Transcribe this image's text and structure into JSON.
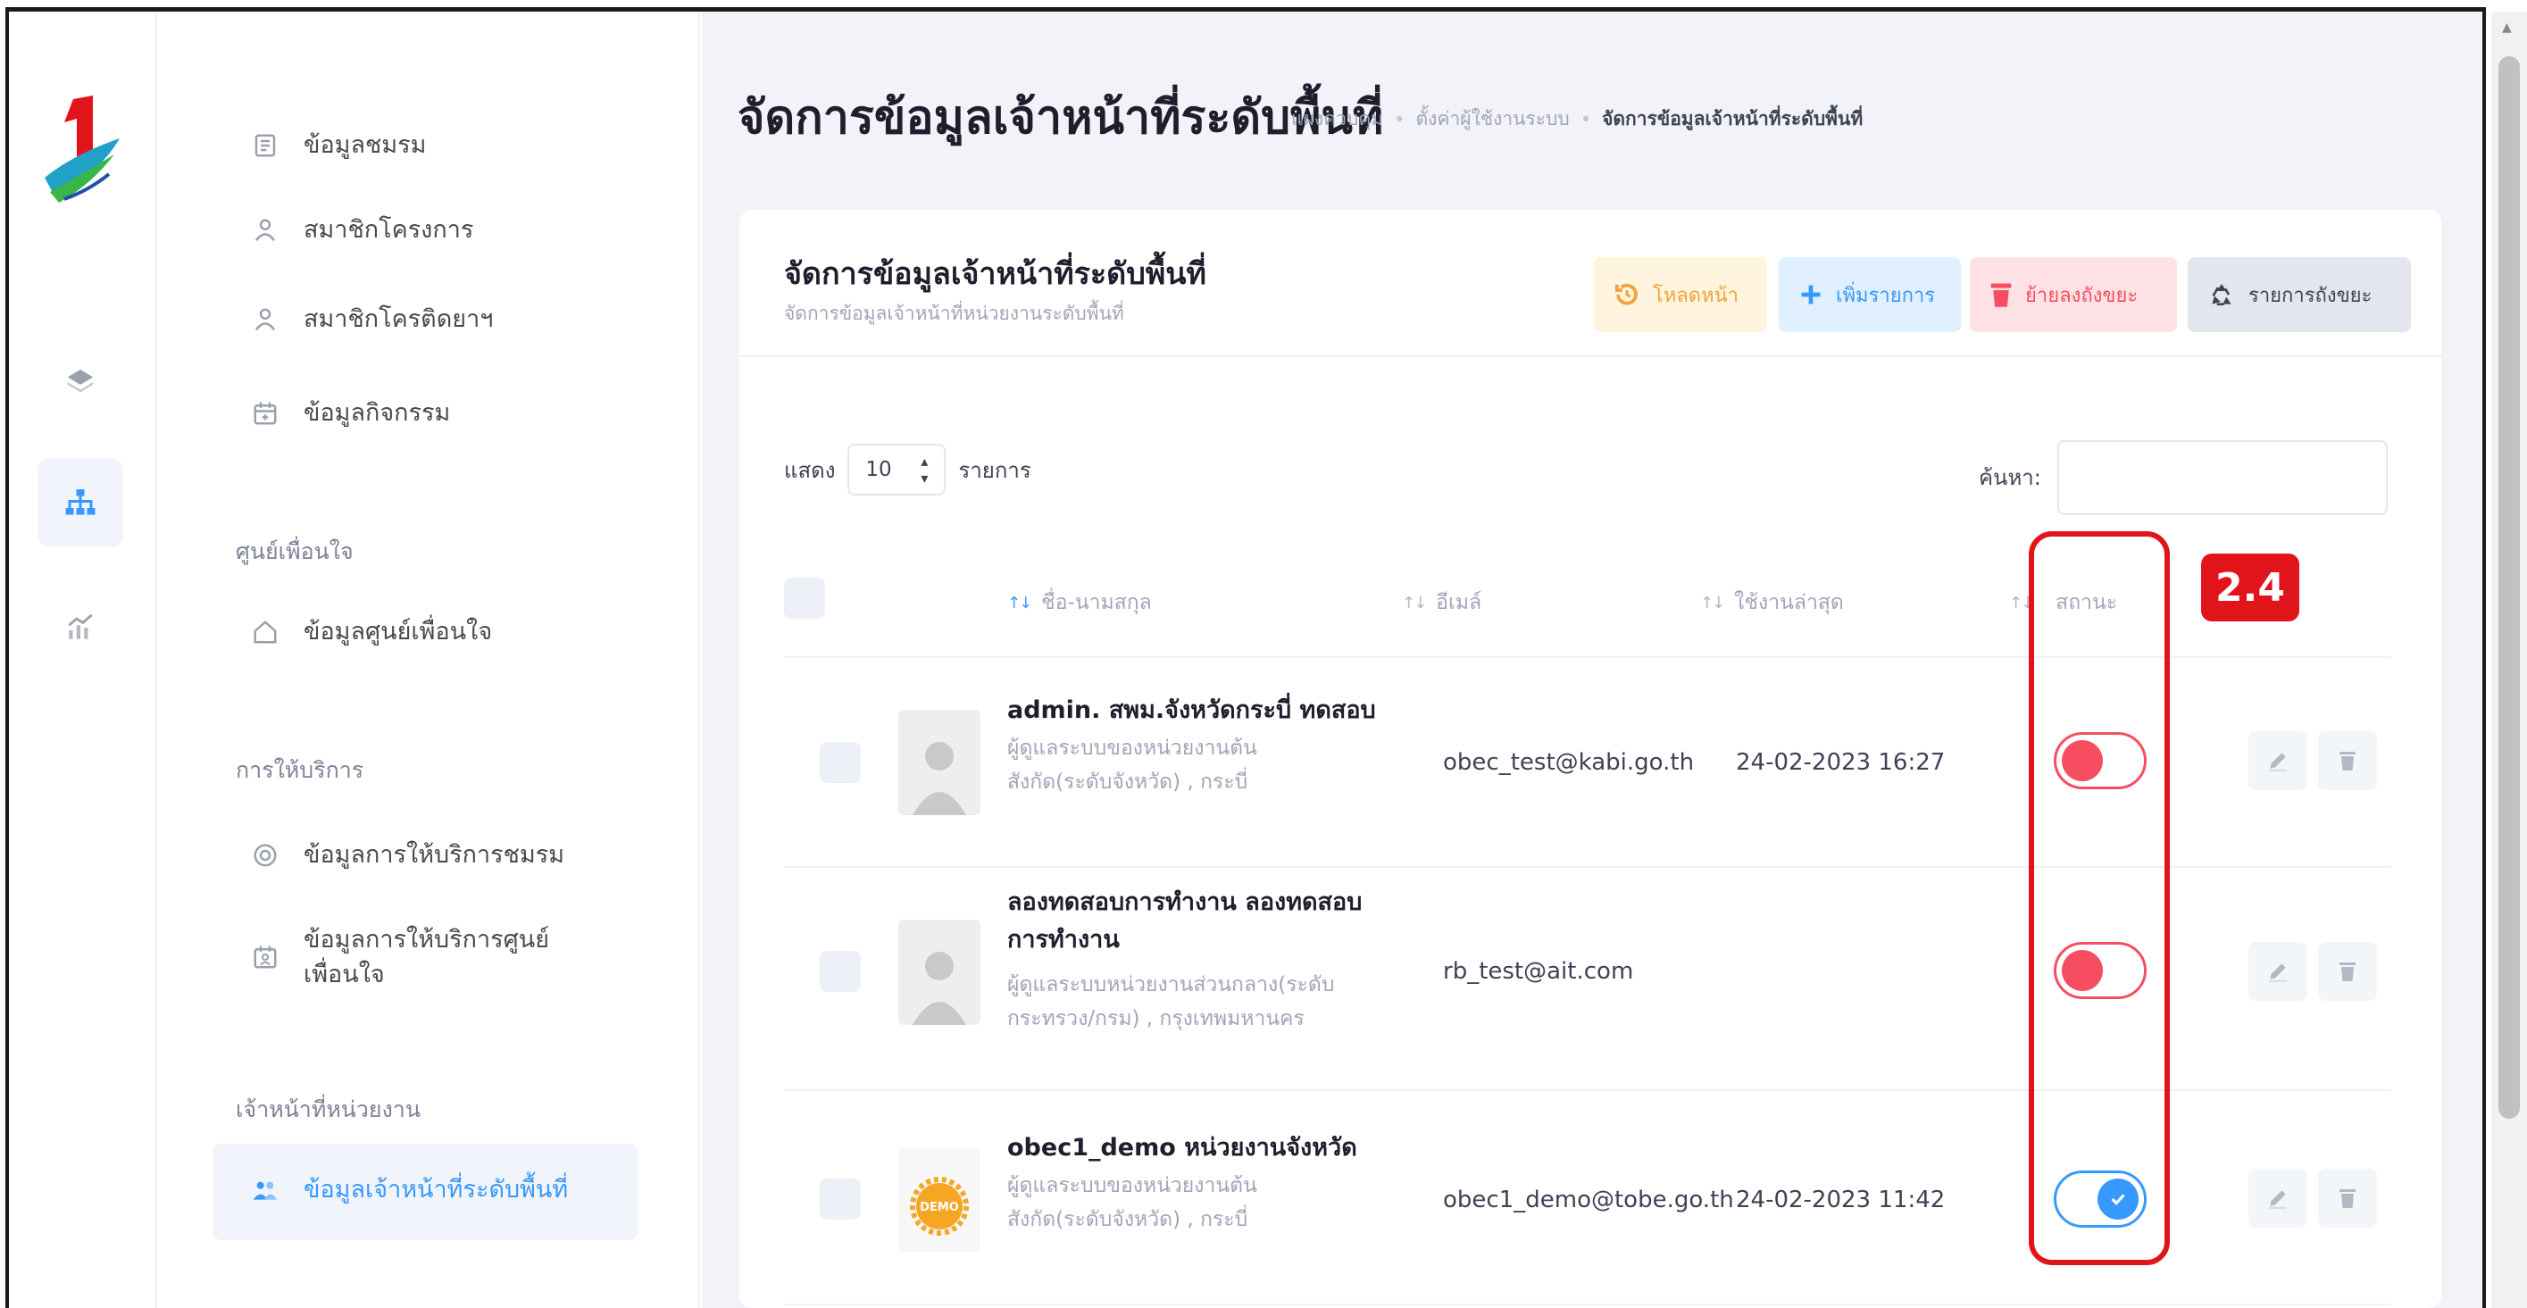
{
  "sidebar": {
    "items_top": [
      {
        "label": "ข้อมูลชมรม",
        "icon": "club-icon"
      },
      {
        "label": "สมาชิกโครงการ",
        "icon": "members-icon"
      },
      {
        "label": "สมาชิกโครติดยาฯ",
        "icon": "members-icon"
      },
      {
        "label": "ข้อมูลกิจกรรม",
        "icon": "calendar-icon"
      }
    ],
    "section_center": "ศูนย์เพื่อนใจ",
    "item_center": "ข้อมูลศูนย์เพื่อนใจ",
    "section_service": "การให้บริการ",
    "item_service_club": "ข้อมูลการให้บริการชมรม",
    "item_service_center_line1": "ข้อมูลการให้บริการศูนย์",
    "item_service_center_line2": "เพื่อนใจ",
    "section_staff": "เจ้าหน้าที่หน่วยงาน",
    "item_staff": "ข้อมูลเจ้าหน้าที่ระดับพื้นที่"
  },
  "header": {
    "title": "จัดการข้อมูลเจ้าหน้าที่ระดับพื้นที่",
    "breadcrumb": [
      "แผงควบคุม",
      "ตั้งค่าผู้ใช้งานระบบ",
      "จัดการข้อมูลเจ้าหน้าที่ระดับพื้นที่"
    ]
  },
  "card": {
    "title": "จัดการข้อมูลเจ้าหน้าที่ระดับพื้นที่",
    "subtitle": "จัดการข้อมูลเจ้าหน้าที่หน่วยงานระดับพื้นที่",
    "buttons": {
      "reload": "โหลดหน้า",
      "add": "เพิ่มรายการ",
      "trash": "ย้ายลงถังขยะ",
      "recycle": "รายการถังขยะ"
    },
    "show_label": "แสดง",
    "page_size": "10",
    "items_label": "รายการ",
    "search_label": "ค้นหา:",
    "search_value": ""
  },
  "table": {
    "headers": {
      "name": "ชื่อ-นามสกุล",
      "email": "อีเมล์",
      "last_used": "ใช้งานล่าสุด",
      "status": "สถานะ"
    },
    "rows": [
      {
        "name": "admin. สพม.จังหวัดกระบี่ ทดสอบ",
        "role_line1": "ผู้ดูแลระบบของหน่วยงานต้น",
        "role_line2": "สังกัด(ระดับจังหวัด) , กระบี่",
        "email": "obec_test@kabi.go.th",
        "last_used": "24-02-2023 16:27",
        "active": false
      },
      {
        "name_line1": "ลองทดสอบการทำงาน ลองทดสอบ",
        "name_line2": "การทำงาน",
        "role_line1": "ผู้ดูแลระบบหน่วยงานส่วนกลาง(ระดับ",
        "role_line2": "กระทรวง/กรม) , กรุงเทพมหานคร",
        "email": "rb_test@ait.com",
        "last_used": "",
        "active": false
      },
      {
        "name": "obec1_demo หน่วยงานจังหวัด",
        "role_line1": "ผู้ดูแลระบบของหน่วยงานต้น",
        "role_line2": "สังกัด(ระดับจังหวัด) , กระบี่",
        "email": "obec1_demo@tobe.go.th",
        "last_used": "24-02-2023 11:42",
        "active": true,
        "avatar_text": "DEMO"
      }
    ]
  },
  "annotation": {
    "badge": "2.4",
    "color": "#e2141b"
  },
  "colors": {
    "primary": "#3699ff",
    "danger": "#f64e60",
    "warning": "#f6a23a"
  }
}
